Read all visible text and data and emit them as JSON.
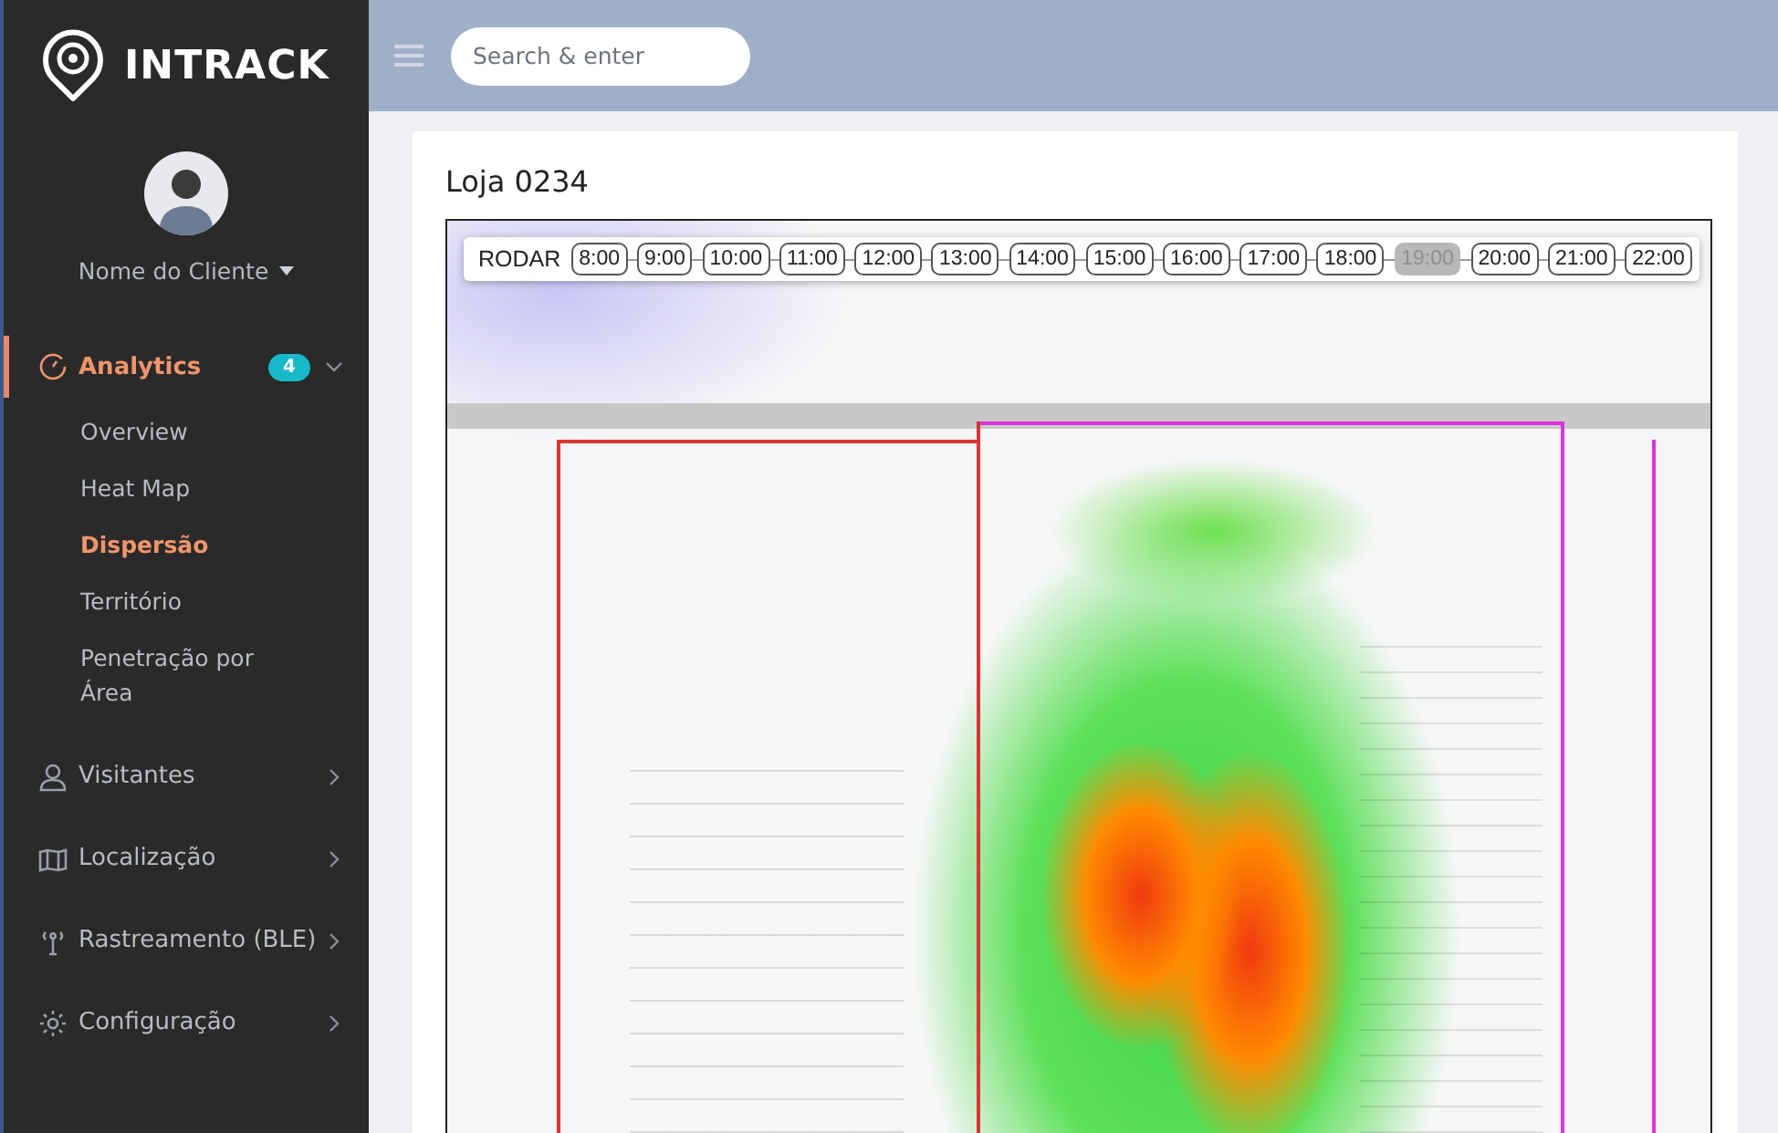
{
  "brand": {
    "name": "INTRACK"
  },
  "search": {
    "placeholder": "Search & enter"
  },
  "user": {
    "name": "Nome do Cliente"
  },
  "sidebar": {
    "items": [
      {
        "label": "Analytics",
        "badge": "4",
        "expanded": true,
        "selected": true,
        "children": [
          {
            "label": "Overview",
            "selected": false
          },
          {
            "label": "Heat Map",
            "selected": false
          },
          {
            "label": "Dispersão",
            "selected": true
          },
          {
            "label": "Território",
            "selected": false
          },
          {
            "label": "Penetração por Área",
            "selected": false
          }
        ]
      },
      {
        "label": "Visitantes",
        "expanded": false,
        "selected": false
      },
      {
        "label": "Localização",
        "expanded": false,
        "selected": false
      },
      {
        "label": "Rastreamento (BLE)",
        "expanded": false,
        "selected": false
      },
      {
        "label": "Configuração",
        "expanded": false,
        "selected": false
      }
    ]
  },
  "page": {
    "title": "Loja 0234"
  },
  "timeline": {
    "play_label": "RODAR",
    "hours": [
      {
        "label": "8:00",
        "selected": false
      },
      {
        "label": "9:00",
        "selected": false
      },
      {
        "label": "10:00",
        "selected": false
      },
      {
        "label": "11:00",
        "selected": false
      },
      {
        "label": "12:00",
        "selected": false
      },
      {
        "label": "13:00",
        "selected": false
      },
      {
        "label": "14:00",
        "selected": false
      },
      {
        "label": "15:00",
        "selected": false
      },
      {
        "label": "16:00",
        "selected": false
      },
      {
        "label": "17:00",
        "selected": false
      },
      {
        "label": "18:00",
        "selected": false
      },
      {
        "label": "19:00",
        "selected": true
      },
      {
        "label": "20:00",
        "selected": false
      },
      {
        "label": "21:00",
        "selected": false
      },
      {
        "label": "22:00",
        "selected": false
      }
    ]
  }
}
